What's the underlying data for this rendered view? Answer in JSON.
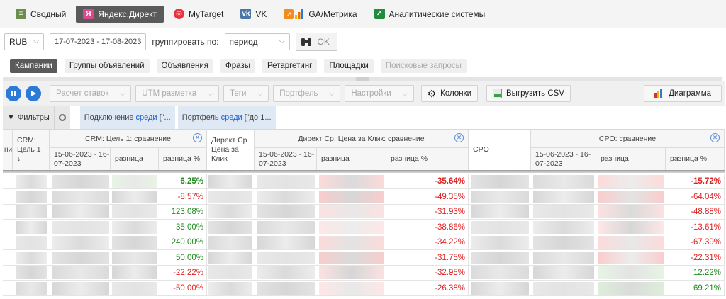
{
  "source_tabs": [
    {
      "label": "Сводный",
      "icon": "summary-icon"
    },
    {
      "label": "Яндекс.Директ",
      "icon": "yandex-icon",
      "active": true
    },
    {
      "label": "MyTarget",
      "icon": "mytarget-icon"
    },
    {
      "label": "VK",
      "icon": "vk-icon"
    },
    {
      "label": "GA/Метрика",
      "icon": "analytics-icon"
    },
    {
      "label": "Аналитические системы",
      "icon": "analytic-systems-icon"
    }
  ],
  "controls": {
    "currency": "RUB",
    "date_range": "17-07-2023 - 17-08-2023",
    "group_by_label": "группировать по:",
    "group_by_value": "период",
    "ok_label": "OK"
  },
  "entity_tabs": [
    {
      "label": "Кампании",
      "active": true
    },
    {
      "label": "Группы объявлений"
    },
    {
      "label": "Объявления"
    },
    {
      "label": "Фразы"
    },
    {
      "label": "Ретаргетинг"
    },
    {
      "label": "Площадки"
    },
    {
      "label": "Поисковые запросы",
      "disabled": true
    }
  ],
  "toolbar": {
    "bid_calc": "Расчет ставок",
    "utm": "UTM разметка",
    "tags": "Теги",
    "portfolio": "Портфель",
    "settings": "Настройки",
    "columns": "Колонки",
    "export": "Выгрузить CSV",
    "chart": "Диаграмма"
  },
  "filters": {
    "label": "Фильтры",
    "chip1": {
      "prefix": "Подключение",
      "op": "среди",
      "value": "[\"..."
    },
    "chip2": {
      "prefix": "Портфель",
      "op": "среди",
      "value": "[\"до 1..."
    }
  },
  "table": {
    "col_cut": "ни",
    "crm_goal": "CRM: Цель 1",
    "sort_arrow": "↓",
    "group1": "CRM: Цель 1: сравнение",
    "period": "15-06-2023 - 16-07-2023",
    "diff": "разница",
    "diff_pct": "разница %",
    "cpc_line1": "Директ Ср.",
    "cpc_line2": "Цена за",
    "cpc_line3": "Клик",
    "group2": "Директ Ср. Цена за Клик: сравнение",
    "cpo": "CPO",
    "group3": "CPO: сравнение"
  },
  "rows": [
    {
      "crm_pct": "6.25%",
      "cpc_pct": "-35.64%",
      "cpo_pct": "-15.72%"
    },
    {
      "crm_pct": "-8.57%",
      "cpc_pct": "-49.35%",
      "cpo_pct": "-64.04%"
    },
    {
      "crm_pct": "123.08%",
      "cpc_pct": "-31.93%",
      "cpo_pct": "-48.88%"
    },
    {
      "crm_pct": "35.00%",
      "cpc_pct": "-38.86%",
      "cpo_pct": "-13.61%"
    },
    {
      "crm_pct": "240.00%",
      "cpc_pct": "-34.22%",
      "cpo_pct": "-67.39%"
    },
    {
      "crm_pct": "50.00%",
      "cpc_pct": "-31.75%",
      "cpo_pct": "-22.31%"
    },
    {
      "crm_pct": "-22.22%",
      "cpc_pct": "-32.95%",
      "cpo_pct": "12.22%"
    },
    {
      "crm_pct": "-50.00%",
      "cpc_pct": "-26.38%",
      "cpo_pct": "69.21%"
    }
  ],
  "colors": {
    "positive": "#1f8a1f",
    "negative": "#e02020",
    "accent": "#2d7ad6"
  }
}
